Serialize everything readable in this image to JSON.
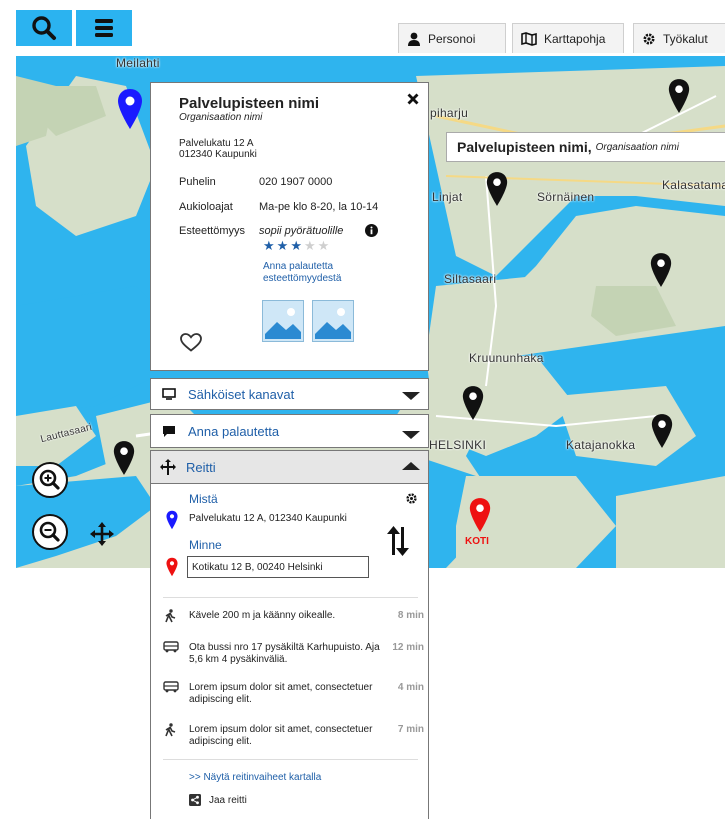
{
  "toolbar": {
    "search_icon": "search-icon",
    "menu_icon": "hamburger-menu-icon",
    "accent_color": "#2bb3f0",
    "tabs": [
      {
        "label": "Personoi",
        "icon": "person-icon"
      },
      {
        "label": "Karttapohja",
        "icon": "map-icon"
      },
      {
        "label": "Työkalut",
        "icon": "gear-icon"
      }
    ]
  },
  "map": {
    "places": [
      "Meilahti",
      "Linjat",
      "Sörnäinen",
      "Kalasatama",
      "Siltasaari",
      "Kruununhaka",
      "Katajanokka",
      "HELSINKI",
      "Lauttasaari",
      "piharju"
    ],
    "home_label": "KOTI",
    "tooltip": {
      "name": "Palvelupisteen nimi,",
      "org": "Organisaation nimi"
    },
    "pin_colors": {
      "selected": "#1a1aff",
      "default": "#111111",
      "home": "#ee1111"
    }
  },
  "card": {
    "title": "Palvelupisteen nimi",
    "subtitle": "Organisaation nimi",
    "address_line1": "Palvelukatu 12 A",
    "address_line2": "012340 Kaupunki",
    "phone_label": "Puhelin",
    "phone_value": "020  1907 0000",
    "hours_label": "Aukioloajat",
    "hours_value": "Ma-pe klo 8-20, la 10-14",
    "access_label": "Esteettömyys",
    "access_value": "sopii pyörätuolille",
    "rating_filled": 3,
    "rating_max": 5,
    "feedback_link": "Anna palautetta esteettömyydestä"
  },
  "accordions": {
    "channels": "Sähköiset kanavat",
    "feedback": "Anna palautetta",
    "route": "Reitti"
  },
  "route": {
    "from_label": "Mistä",
    "from_value": "Palvelukatu 12 A, 012340 Kaupunki",
    "to_label": "Minne",
    "to_value": "Kotikatu 12 B, 00240 Helsinki",
    "steps": [
      {
        "text": "Kävele 200 m ja käänny oikealle.",
        "time": "8 min",
        "icon": "walk-icon"
      },
      {
        "text": "Ota bussi nro 17 pysäkiltä Karhupuisto. Aja 5,6 km 4 pysäkinväliä.",
        "time": "12 min",
        "icon": "bus-icon"
      },
      {
        "text": "Lorem ipsum dolor sit amet, consectetuer adipiscing elit.",
        "time": "4 min",
        "icon": "bus-icon"
      },
      {
        "text": "Lorem ipsum dolor sit amet, consectetuer adipiscing elit.",
        "time": "7 min",
        "icon": "walk-icon"
      }
    ],
    "show_on_map": ">> Näytä reitinvaiheet kartalla",
    "share": "Jaa reitti"
  }
}
